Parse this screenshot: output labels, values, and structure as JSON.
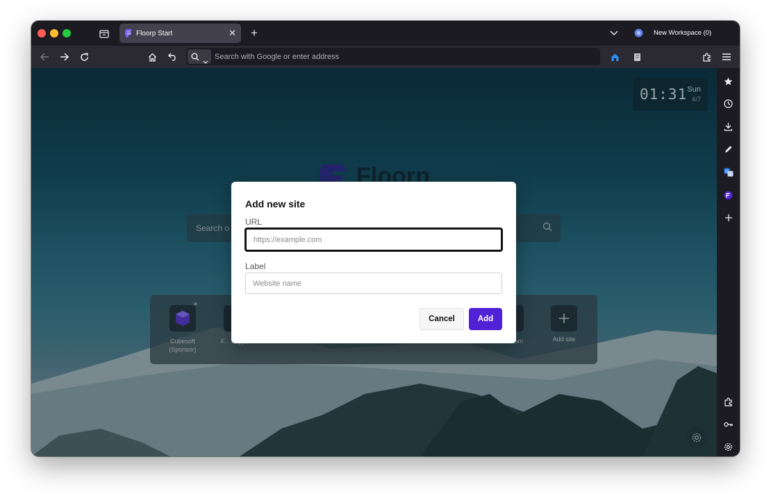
{
  "window": {
    "tab": {
      "title": "Floorp Start",
      "close_glyph": "✕"
    },
    "new_tab_glyph": "+",
    "workspace": {
      "label": "New Workspace (0)"
    }
  },
  "navbar": {
    "url_placeholder": "Search with Google or enter address"
  },
  "page": {
    "clock": {
      "time": "01:31",
      "day": "Sun",
      "date": "6/7"
    },
    "logo_text": "Floorp",
    "search_placeholder": "Search o",
    "shortcuts": [
      {
        "label": "Cubesoft (Sponsor)"
      },
      {
        "label": "F... Support"
      },
      {
        "label": "...am"
      },
      {
        "label": "Add site"
      }
    ]
  },
  "dialog": {
    "title": "Add new site",
    "url_label": "URL",
    "url_placeholder": "https://example.com",
    "label_label": "Label",
    "label_placeholder": "Website name",
    "cancel_label": "Cancel",
    "add_label": "Add"
  },
  "sidebar": {
    "icons": [
      "star-icon",
      "history-icon",
      "download-icon",
      "pen-icon",
      "translate-icon",
      "floorp-icon",
      "plus-icon",
      "extensions-icon",
      "key-icon",
      "settings-icon"
    ]
  },
  "colors": {
    "accent": "#4f22d6",
    "chrome_dark": "#1c1b22",
    "toolbar": "#2b2a33"
  }
}
